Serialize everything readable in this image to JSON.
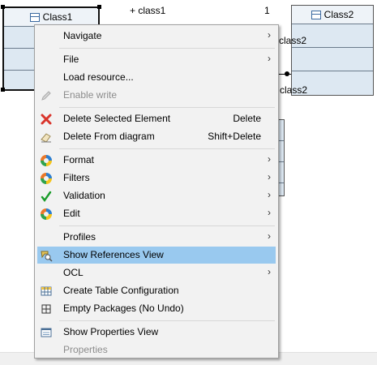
{
  "diagram": {
    "class1_name": "Class1",
    "class2_name": "Class2",
    "role_top": "+ class1",
    "multiplicity_top": "1",
    "role_right_upper": "class2",
    "role_right_lower": "class2"
  },
  "menu": {
    "items": [
      {
        "label": "Navigate",
        "has_submenu": true,
        "icon": ""
      },
      {
        "label": "File",
        "has_submenu": true,
        "icon": ""
      },
      {
        "label": "Load resource...",
        "icon": ""
      },
      {
        "label": "Enable write",
        "disabled": true,
        "icon": "pencil-icon"
      },
      {
        "label": "Delete Selected Element",
        "accelerator": "Delete",
        "icon": "delete-x-icon"
      },
      {
        "label": "Delete From diagram",
        "accelerator": "Shift+Delete",
        "icon": "eraser-icon"
      },
      {
        "label": "Format",
        "has_submenu": true,
        "icon": "swirl-icon"
      },
      {
        "label": "Filters",
        "has_submenu": true,
        "icon": "swirl-icon"
      },
      {
        "label": "Validation",
        "has_submenu": true,
        "icon": "check-icon"
      },
      {
        "label": "Edit",
        "has_submenu": true,
        "icon": "swirl-icon"
      },
      {
        "label": "Profiles",
        "has_submenu": true,
        "icon": ""
      },
      {
        "label": "Show References View",
        "highlighted": true,
        "icon": "references-icon"
      },
      {
        "label": "OCL",
        "has_submenu": true,
        "icon": ""
      },
      {
        "label": "Create Table Configuration",
        "icon": "table-icon"
      },
      {
        "label": "Empty Packages (No Undo)",
        "icon": "grid-icon"
      },
      {
        "label": "Show Properties View",
        "icon": "properties-icon"
      },
      {
        "label": "Properties",
        "disabled": true,
        "icon": ""
      }
    ],
    "submenu_arrow": "›"
  }
}
